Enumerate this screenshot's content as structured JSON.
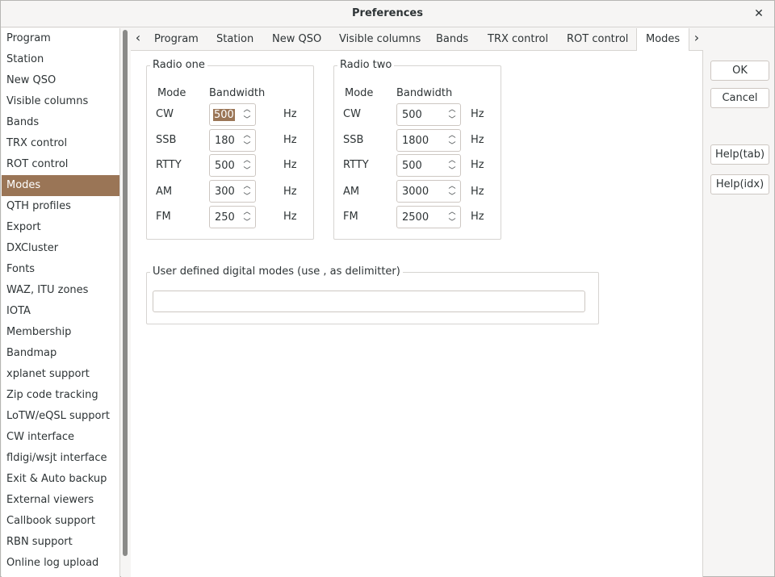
{
  "window": {
    "title": "Preferences"
  },
  "sidebar": {
    "items": [
      {
        "label": "Program"
      },
      {
        "label": "Station"
      },
      {
        "label": "New QSO"
      },
      {
        "label": "Visible columns"
      },
      {
        "label": "Bands"
      },
      {
        "label": "TRX control"
      },
      {
        "label": "ROT control"
      },
      {
        "label": "Modes"
      },
      {
        "label": "QTH profiles"
      },
      {
        "label": "Export"
      },
      {
        "label": "DXCluster"
      },
      {
        "label": "Fonts"
      },
      {
        "label": "WAZ, ITU zones"
      },
      {
        "label": "IOTA"
      },
      {
        "label": "Membership"
      },
      {
        "label": "Bandmap"
      },
      {
        "label": "xplanet support"
      },
      {
        "label": "Zip code tracking"
      },
      {
        "label": "LoTW/eQSL support"
      },
      {
        "label": "CW interface"
      },
      {
        "label": "fldigi/wsjt interface"
      },
      {
        "label": "Exit & Auto backup"
      },
      {
        "label": "External viewers"
      },
      {
        "label": "Callbook support"
      },
      {
        "label": "RBN support"
      },
      {
        "label": "Online log upload"
      }
    ],
    "selected": "Modes"
  },
  "tabs": {
    "items": [
      {
        "label": "Program"
      },
      {
        "label": "Station"
      },
      {
        "label": "New QSO"
      },
      {
        "label": "Visible columns"
      },
      {
        "label": "Bands"
      },
      {
        "label": "TRX control"
      },
      {
        "label": "ROT control"
      },
      {
        "label": "Modes"
      }
    ],
    "active": "Modes"
  },
  "radio_one": {
    "title": "Radio one",
    "mode_header": "Mode",
    "bandwidth_header": "Bandwidth",
    "unit": "Hz",
    "rows": [
      {
        "mode": "CW",
        "value": "500"
      },
      {
        "mode": "SSB",
        "value": "180"
      },
      {
        "mode": "RTTY",
        "value": "500"
      },
      {
        "mode": "AM",
        "value": "300"
      },
      {
        "mode": "FM",
        "value": "250"
      }
    ]
  },
  "radio_two": {
    "title": "Radio two",
    "mode_header": "Mode",
    "bandwidth_header": "Bandwidth",
    "unit": "Hz",
    "rows": [
      {
        "mode": "CW",
        "value": "500"
      },
      {
        "mode": "SSB",
        "value": "1800"
      },
      {
        "mode": "RTTY",
        "value": "500"
      },
      {
        "mode": "AM",
        "value": "3000"
      },
      {
        "mode": "FM",
        "value": "2500"
      }
    ]
  },
  "user_modes": {
    "title": "User defined digital modes (use , as delimitter)",
    "value": ""
  },
  "buttons": {
    "ok": "OK",
    "cancel": "Cancel",
    "help_tab": "Help(tab)",
    "help_idx": "Help(idx)"
  },
  "colors": {
    "accent": "#9a7556"
  }
}
